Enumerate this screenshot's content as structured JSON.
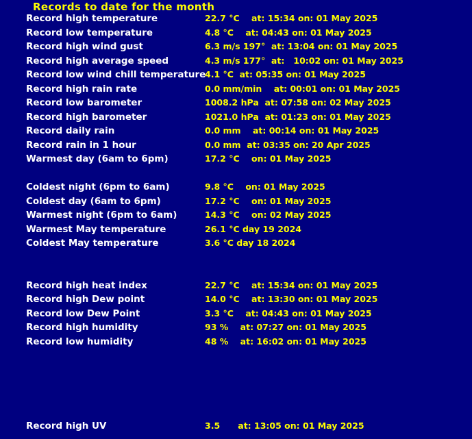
{
  "page": {
    "title": "Records to date for the month",
    "background_color": "#000080",
    "label_color": "#ffffff",
    "value_color": "#ffff00"
  },
  "rows": [
    {
      "label": "Record high temperature",
      "value": "22.7 °C    at: 15:34 on: 01 May 2025"
    },
    {
      "label": "Record low temperature",
      "value": "4.8 °C    at: 04:43 on: 01 May 2025"
    },
    {
      "label": "Record high wind gust",
      "value": "6.3 m/s 197°  at: 13:04 on: 01 May 2025"
    },
    {
      "label": "Record high average speed",
      "value": "4.3 m/s 177°  at:   10:02 on: 01 May 2025"
    },
    {
      "label": "Record low wind chill temperature",
      "value": "4.1 °C  at: 05:35 on: 01 May 2025"
    },
    {
      "label": "Record high rain rate",
      "value": "0.0 mm/min    at: 00:01 on: 01 May 2025"
    },
    {
      "label": "Record low barometer",
      "value": "1008.2 hPa  at: 07:58 on: 02 May 2025"
    },
    {
      "label": "Record high barometer",
      "value": "1021.0 hPa  at: 01:23 on: 01 May 2025"
    },
    {
      "label": "Record daily rain",
      "value": "0.0 mm    at: 00:14 on: 01 May 2025"
    },
    {
      "label": "Record rain in 1 hour",
      "value": "0.0 mm  at: 03:35 on: 20 Apr 2025"
    },
    {
      "label": "Warmest day (6am to 6pm)",
      "value": "17.2 °C    on: 01 May 2025"
    },
    {
      "label": "",
      "value": ""
    },
    {
      "label": "Coldest night (6pm to 6am)",
      "value": "9.8 °C    on: 01 May 2025"
    },
    {
      "label": "Coldest day (6am to 6pm)",
      "value": "17.2 °C    on: 01 May 2025"
    },
    {
      "label": "Warmest night (6pm to 6am)",
      "value": "14.3 °C    on: 02 May 2025"
    },
    {
      "label": "Warmest May temperature",
      "value": "26.1 °C day 19 2024"
    },
    {
      "label": "Coldest May temperature",
      "value": "3.6 °C day 18 2024"
    },
    {
      "label": "",
      "value": ""
    },
    {
      "label": "",
      "value": ""
    },
    {
      "label": "Record high heat index",
      "value": "22.7 °C    at: 15:34 on: 01 May 2025"
    },
    {
      "label": "Record high Dew point",
      "value": "14.0 °C    at: 13:30 on: 01 May 2025"
    },
    {
      "label": "Record low Dew Point",
      "value": "3.3 °C    at: 04:43 on: 01 May 2025"
    },
    {
      "label": "Record high humidity",
      "value": "93 %    at: 07:27 on: 01 May 2025"
    },
    {
      "label": "Record low humidity",
      "value": "48 %    at: 16:02 on: 01 May 2025"
    },
    {
      "label": "",
      "value": ""
    },
    {
      "label": "",
      "value": ""
    },
    {
      "label": "",
      "value": ""
    },
    {
      "label": "",
      "value": ""
    },
    {
      "label": "",
      "value": ""
    },
    {
      "label": "Record high UV",
      "value": "3.5      at: 13:05 on: 01 May 2025"
    }
  ]
}
